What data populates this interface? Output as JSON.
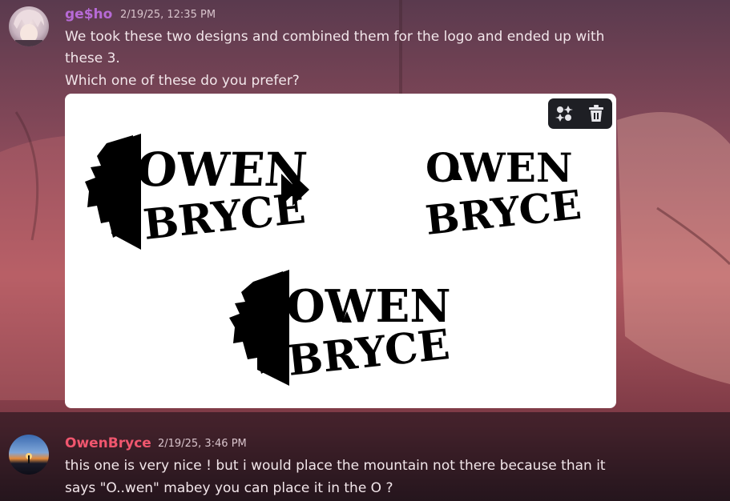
{
  "messages": [
    {
      "author": "ge$ho",
      "author_color": "#b76ad6",
      "timestamp": "2/19/25, 12:35 PM",
      "lines": [
        "We took these two designs and combined them for the logo and ended up with",
        "these 3.",
        "Which one of these do you prefer?"
      ],
      "attachment": {
        "logos": [
          {
            "line1": "OWEN",
            "line2": "BRYCE"
          },
          {
            "line1": "OWEN",
            "line2": "BRYCE"
          },
          {
            "line1": "OWEN",
            "line2": "BRYCE"
          }
        ],
        "toolbar": {
          "edit_icon": "sparkle-edit-icon",
          "delete_icon": "trash-icon"
        }
      }
    },
    {
      "author": "OwenBryce",
      "author_color": "#f0566e",
      "timestamp": "2/19/25, 3:46 PM",
      "lines": [
        "this one is very nice ! but i would place the mountain not there because than it",
        "says \"O..wen\" mabey you can place it in the O ?"
      ]
    }
  ]
}
